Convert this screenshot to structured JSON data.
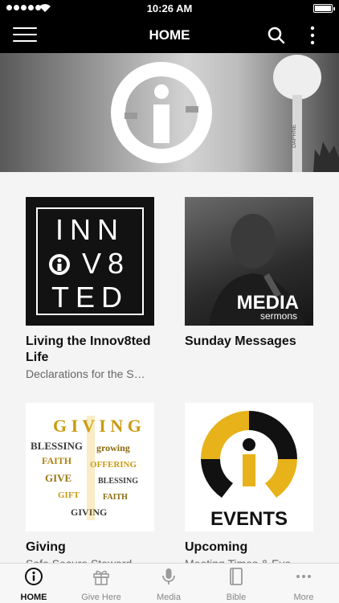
{
  "status": {
    "time": "10:26 AM"
  },
  "nav": {
    "title": "HOME"
  },
  "hero": {
    "tower_text": "DAPHNE"
  },
  "cards": [
    {
      "title": "Living the Innov8ted Life",
      "subtitle": "Declarations for the S…",
      "art_lines": [
        "INN",
        "V8",
        "TED"
      ]
    },
    {
      "title": "Sunday Messages",
      "subtitle": "",
      "art_title": "MEDIA",
      "art_sub": "sermons"
    },
    {
      "title": "Giving",
      "subtitle": "Safe Secure Steward…",
      "art_word": "GIVING"
    },
    {
      "title": "Upcoming",
      "subtitle": "Meeting Times & Eve…",
      "art_label": "EVENTS"
    }
  ],
  "tabs": [
    {
      "label": "HOME",
      "icon": "info-icon"
    },
    {
      "label": "Give Here",
      "icon": "gift-icon"
    },
    {
      "label": "Media",
      "icon": "microphone-icon"
    },
    {
      "label": "Bible",
      "icon": "book-icon"
    },
    {
      "label": "More",
      "icon": "more-icon"
    }
  ],
  "colors": {
    "accent_gold": "#e7b21a",
    "bar": "#000000"
  }
}
